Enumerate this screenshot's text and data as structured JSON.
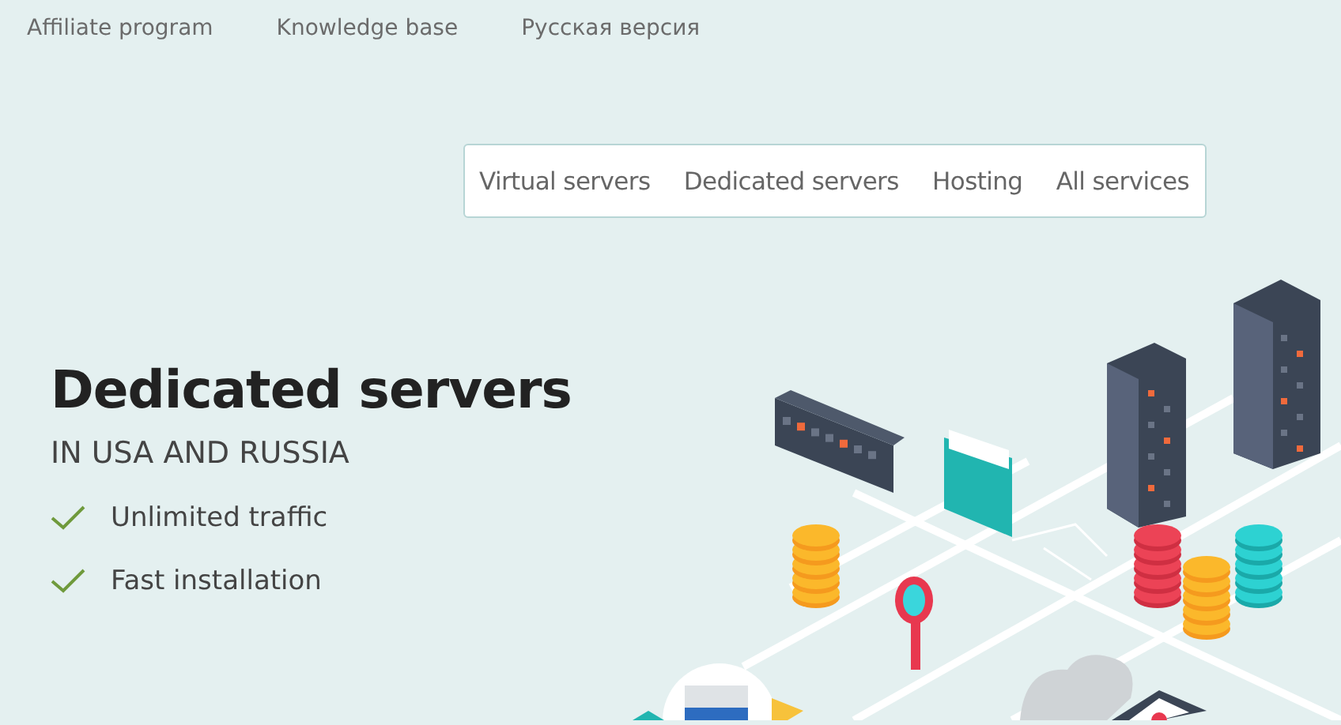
{
  "top_links": [
    "Affiliate program",
    "Knowledge base",
    "Русская версия"
  ],
  "nav": [
    "Virtual servers",
    "Dedicated servers",
    "Hosting",
    "All services"
  ],
  "hero": {
    "title": "Dedicated servers",
    "subtitle": "IN USA AND RUSSIA",
    "features": [
      "Unlimited traffic",
      "Fast installation"
    ]
  }
}
